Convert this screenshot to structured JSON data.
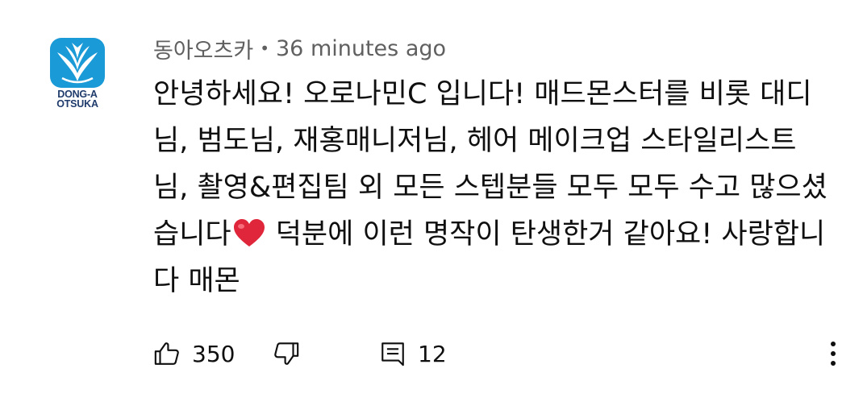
{
  "comment": {
    "author": "동아오츠카",
    "separator": "•",
    "time": "36 minutes ago",
    "avatar": {
      "logo_line1": "DONG-A",
      "logo_line2": "OTSUKA",
      "brand_color": "#1a9ad6"
    },
    "lines": [
      "안녕하세요! 오로나민C 입니다! 매드몬스터를 비롯 대디",
      "님, 범도님, 재홍매니저님, 헤어 메이크업 스타일리스트",
      "님, 촬영&편집팀 외 모든 스텝분들 모두 모두 수고 많으셨"
    ],
    "line4_before_heart": "습니다",
    "line4_after_heart": " 덕분에 이런 명작이 탄생한거 같아요! 사랑합니",
    "line5": "다 매몬",
    "emoji": "heart-emoji"
  },
  "actions": {
    "like_count": "350",
    "reply_count": "12",
    "icons": [
      "thumbs-up-icon",
      "thumbs-down-icon",
      "reply-icon",
      "more-vertical-icon"
    ]
  }
}
